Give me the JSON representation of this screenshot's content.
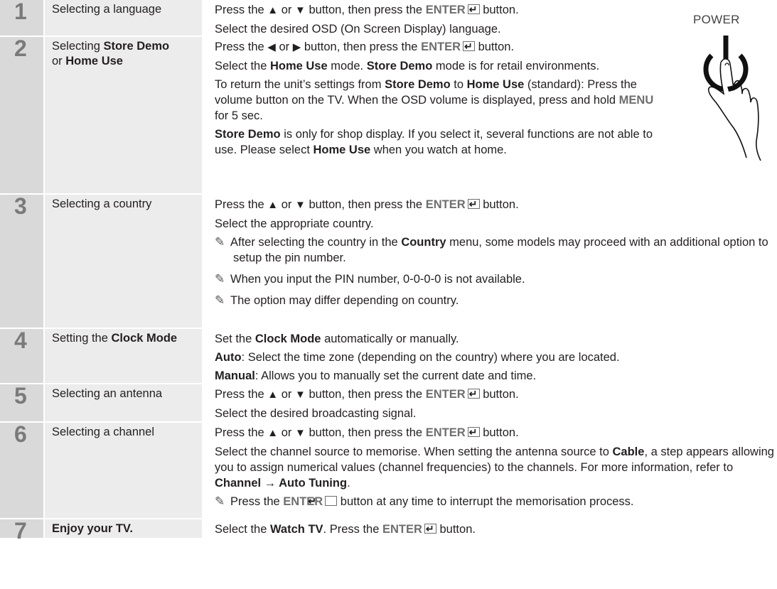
{
  "power_label": "POWER",
  "arrows": {
    "up": "▲",
    "down": "▼",
    "left": "◀",
    "right": "▶"
  },
  "common": {
    "press_the": "Press the",
    "or": "or",
    "button_then_press_the": "button, then press the",
    "enter": "ENTER",
    "button_end": "button."
  },
  "steps": [
    {
      "number": "1",
      "title": "Selecting a language",
      "select_line": "Select the desired OSD (On Screen Display) language."
    },
    {
      "number": "2",
      "title_pre": "Selecting ",
      "title_b1": "Store Demo",
      "title_mid": "or ",
      "title_b2": "Home Use",
      "p1_a": "Select the ",
      "p1_b": "Home Use",
      "p1_c": " mode. ",
      "p1_d": "Store Demo",
      "p1_e": " mode is for retail environments.",
      "p2_a": "To return the unit’s settings from ",
      "p2_b": "Store Demo",
      "p2_c": " to ",
      "p2_d": "Home Use",
      "p2_e": " (standard): Press the volume button on the TV. When the OSD volume is displayed, press and hold ",
      "p2_f": "MENU",
      "p2_g": " for 5 sec.",
      "p3_a": "Store Demo",
      "p3_b": " is only for shop display. If you select it, several functions are not able to use. Please select ",
      "p3_c": "Home Use",
      "p3_d": " when you watch at home."
    },
    {
      "number": "3",
      "title": "Selecting a country",
      "select_line": "Select the appropriate country.",
      "note1_a": "After selecting the country in the ",
      "note1_b": "Country",
      "note1_c": " menu, some models may proceed with an additional option to setup the pin number.",
      "note2": "When you input the PIN number, 0-0-0-0 is not available.",
      "note3": "The option may differ depending on country."
    },
    {
      "number": "4",
      "title_pre": "Setting the ",
      "title_b": "Clock Mode",
      "l1_a": "Set the ",
      "l1_b": "Clock Mode",
      "l1_c": " automatically or manually.",
      "l2_a": "Auto",
      "l2_b": ": Select the time zone (depending on the country) where you are located.",
      "l3_a": "Manual",
      "l3_b": ": Allows you to manually set the current date and time."
    },
    {
      "number": "5",
      "title": "Selecting an antenna",
      "select_line": "Select the desired broadcasting signal."
    },
    {
      "number": "6",
      "title": "Selecting a channel",
      "p_a": "Select the channel source to memorise. When setting the antenna source to ",
      "p_b": "Cable",
      "p_c": ", a step appears allowing you to assign numerical values (channel frequencies) to the channels. For more information, refer to ",
      "p_d": "Channel → Auto Tuning",
      "p_e": ".",
      "note_a": "Press the ",
      "note_b": "ENTER",
      "note_c": " button at any time to interrupt the memorisation process."
    },
    {
      "number": "7",
      "title": "Enjoy your TV.",
      "l_a": "Select the ",
      "l_b": "Watch TV",
      "l_c": ". Press the ",
      "l_d": "ENTER",
      "l_e": " button."
    }
  ]
}
